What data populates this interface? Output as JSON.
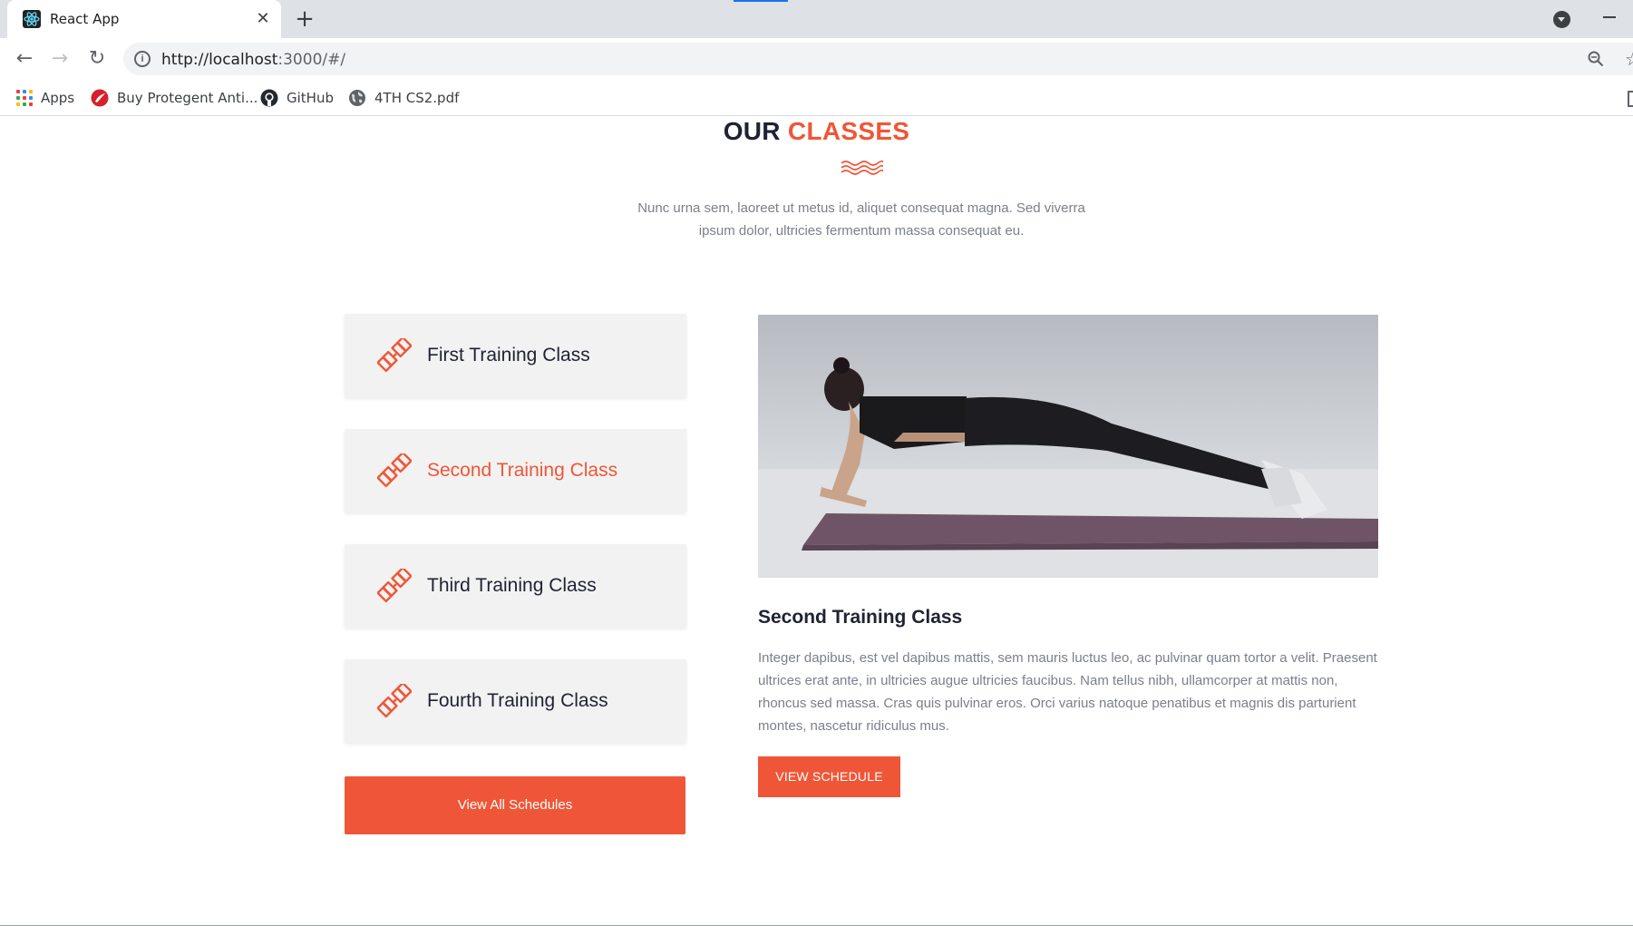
{
  "browser": {
    "tab_title": "React App",
    "tab_close": "✕",
    "new_tab": "+",
    "back": "←",
    "forward": "→",
    "reload": "↻",
    "info": "i",
    "url_host": "http://localhost",
    "url_rest": ":3000/#/",
    "star": "☆",
    "bookmarks": [
      {
        "label": "Apps",
        "icon": "apps-grid-icon"
      },
      {
        "label": "Buy Protegent Anti...",
        "icon": "protegent-icon"
      },
      {
        "label": "GitHub",
        "icon": "github-icon"
      },
      {
        "label": "4TH CS2.pdf",
        "icon": "globe-icon"
      }
    ]
  },
  "colors": {
    "accent": "#ef5637",
    "heading": "#1f2233",
    "body_text": "#7b7f8b",
    "card_bg": "#f2f2f2"
  },
  "section": {
    "heading_prefix": "OUR",
    "heading_accent": "CLASSES",
    "subtitle": "Nunc urna sem, laoreet ut metus id, aliquet consequat magna. Sed viverra ipsum dolor, ultricies fermentum massa consequat eu."
  },
  "classes": [
    {
      "label": "First Training Class",
      "active": false,
      "icon": "dumbbell-icon"
    },
    {
      "label": "Second Training Class",
      "active": true,
      "icon": "dumbbell-icon"
    },
    {
      "label": "Third Training Class",
      "active": false,
      "icon": "dumbbell-icon"
    },
    {
      "label": "Fourth Training Class",
      "active": false,
      "icon": "dumbbell-icon"
    }
  ],
  "view_all_label": "View All Schedules",
  "detail": {
    "title": "Second Training Class",
    "text": "Integer dapibus, est vel dapibus mattis, sem mauris luctus leo, ac pulvinar quam tortor a velit. Praesent ultrices erat ante, in ultricies augue ultricies faucibus. Nam tellus nibh, ullamcorper at mattis non, rhoncus sed massa. Cras quis pulvinar eros. Orci varius natoque penatibus et magnis dis parturient montes, nascetur ridiculus mus.",
    "button_label": "VIEW SCHEDULE",
    "image": "woman-plank-photo"
  }
}
